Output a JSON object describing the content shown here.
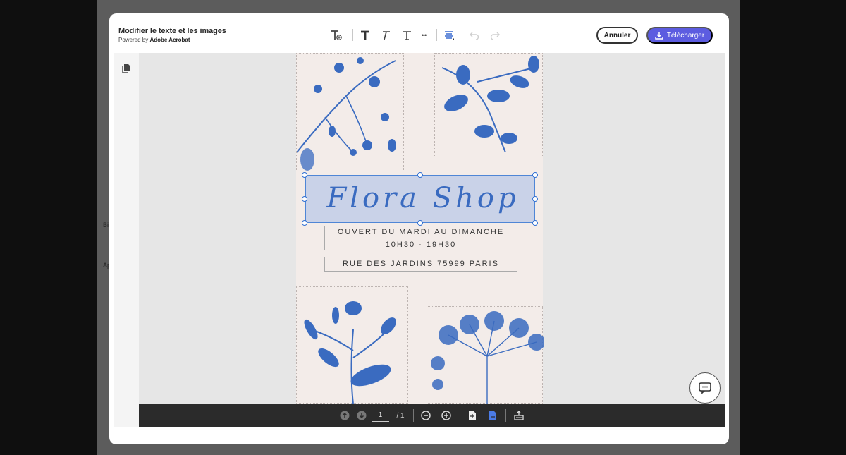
{
  "background": {
    "left_labels": [
      "Bil",
      "Ap"
    ]
  },
  "dialog": {
    "title": "Modifier le texte et les images",
    "subtitle_prefix": "Powered by",
    "subtitle_brand": "Adobe Acrobat",
    "cancel_label": "Annuler",
    "download_label": "Télécharger"
  },
  "toolbar": {
    "tools": [
      "add-text-icon",
      "bold-text-icon",
      "italic-text-icon",
      "text-style-icon",
      "more-icon",
      "align-icon",
      "undo-icon",
      "redo-icon"
    ],
    "more_label": "•••"
  },
  "document": {
    "heading": "Flora Shop",
    "hours_line1": "OUVERT DU MARDI AU DIMANCHE",
    "hours_line2": "10H30 · 19H30",
    "address": "RUE DES JARDINS 75999 PARIS"
  },
  "bottombar": {
    "page_current": "1",
    "page_total": "/ 1"
  },
  "colors": {
    "accent": "#5c5ce0",
    "selection": "#4f86d6",
    "flower_blue": "#3a6bc0"
  }
}
